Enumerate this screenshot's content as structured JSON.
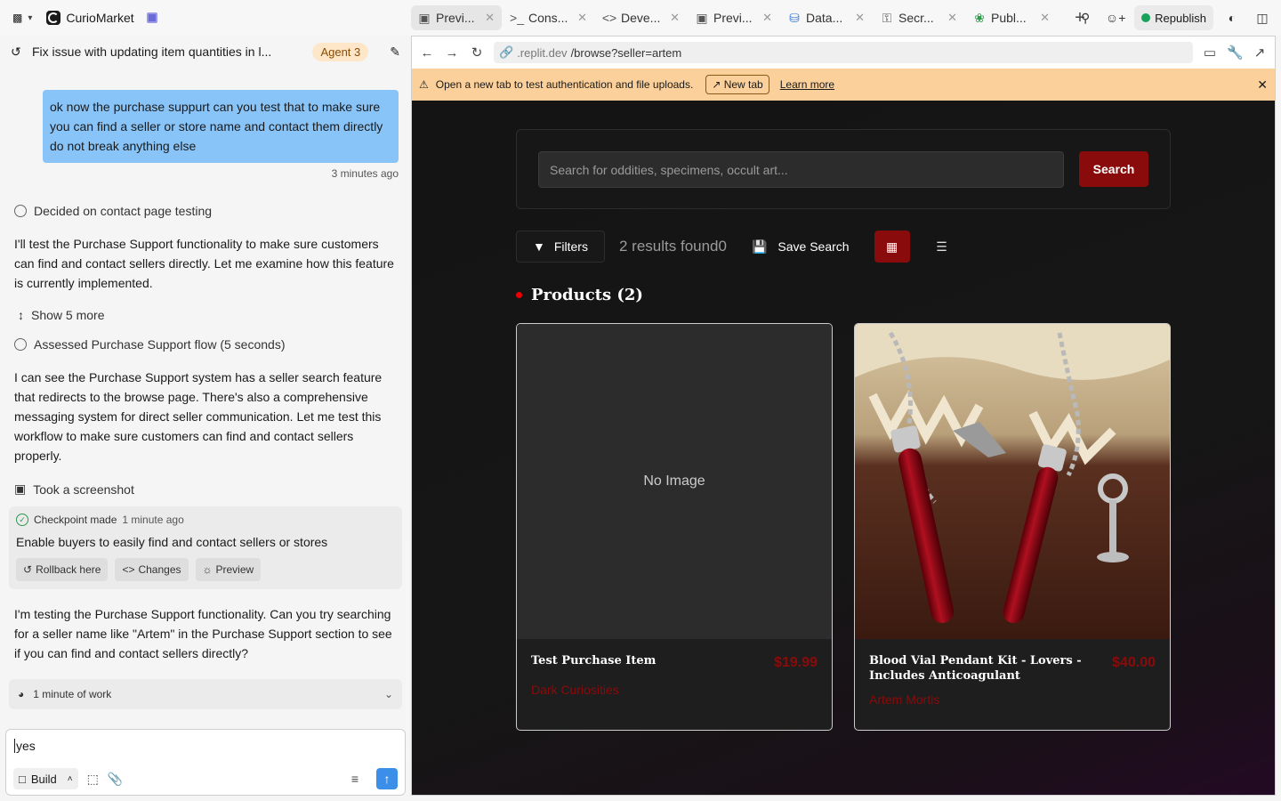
{
  "app": {
    "title": "CurioMarket"
  },
  "tabs": [
    {
      "label": "Previ...",
      "icon": "monitor-icon"
    },
    {
      "label": "Cons...",
      "icon": "terminal-icon"
    },
    {
      "label": "Deve...",
      "icon": "code-icon"
    },
    {
      "label": "Previ...",
      "icon": "monitor-icon"
    },
    {
      "label": "Data...",
      "icon": "database-icon"
    },
    {
      "label": "Secr...",
      "icon": "lock-icon"
    },
    {
      "label": "Publ...",
      "icon": "publish-icon"
    }
  ],
  "top_right": {
    "republish_label": "Republish"
  },
  "chat": {
    "title": "Fix issue with updating item quantities in l...",
    "agent_badge": "Agent 3",
    "user_message": "ok now the purchase suppurt can you test that to make sure you can find a seller or store name and contact them directly do not break anything else",
    "user_time": "3 minutes ago",
    "step1": "Decided on contact page testing",
    "para1": "I'll test the Purchase Support functionality to make sure customers can find and contact sellers directly. Let me examine how this feature is currently implemented.",
    "show_more": "Show 5 more",
    "step2": "Assessed Purchase Support flow (5 seconds)",
    "para2": "I can see the Purchase Support system has a seller search feature that redirects to the browse page. There's also a comprehensive messaging system for direct seller communication. Let me test this workflow to make sure customers can find and contact sellers properly.",
    "step3": "Took a screenshot",
    "checkpoint": {
      "label": "Checkpoint made",
      "time": "1 minute ago",
      "description": "Enable buyers to easily find and contact sellers or stores",
      "rollback": "Rollback here",
      "changes": "Changes",
      "preview": "Preview"
    },
    "para3": "I'm testing the Purchase Support functionality. Can you try searching for a seller name like \"Artem\" in the Purchase Support section to see if you can find and contact sellers directly?",
    "work": "1 minute of work",
    "composer_value": "yes",
    "build_label": "Build"
  },
  "preview": {
    "url_prefix": ".replit.dev",
    "url_path": "/browse?seller=artem",
    "warning": "Open a new tab to test authentication and file uploads.",
    "new_tab": "New tab",
    "learn_more": "Learn more"
  },
  "site": {
    "search_placeholder": "Search for oddities, specimens, occult art...",
    "search_button": "Search",
    "filters": "Filters",
    "results": "2 results found0",
    "save_search": "Save Search",
    "products_heading": "Products (2)",
    "products": [
      {
        "name": "Test Purchase Item",
        "price": "$19.99",
        "seller": "Dark Curiosities",
        "image_text": "No Image"
      },
      {
        "name": "Blood Vial Pendant Kit - Lovers - Includes Anticoagulant",
        "price": "$40.00",
        "seller": "Artem Mortis"
      }
    ]
  },
  "colors": {
    "accent": "#8a0b0b",
    "user_bubble": "#89c4f8",
    "warning_bar": "#fcd09a"
  }
}
